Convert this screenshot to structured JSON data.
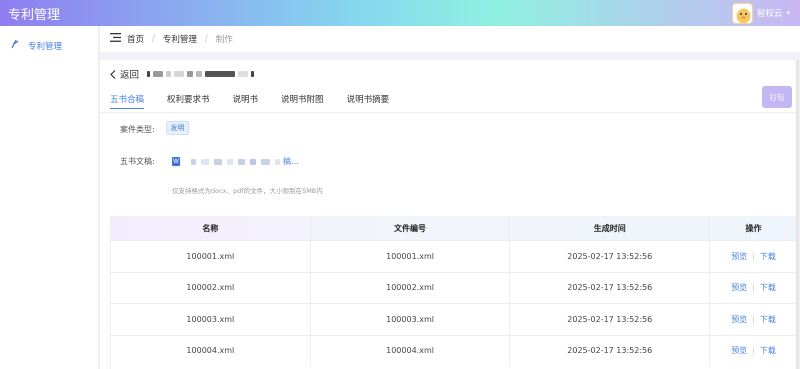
{
  "app": {
    "title": "专利管理",
    "user_name": "智权云"
  },
  "sidebar": {
    "items": [
      {
        "label": "专利管理",
        "icon": "patent-icon"
      }
    ]
  },
  "breadcrumb": {
    "items": [
      "首页",
      "专利管理",
      "制作"
    ]
  },
  "page": {
    "back_label": "返回"
  },
  "tabs": [
    "五书合稿",
    "权利要求书",
    "说明书",
    "说明书附图",
    "说明书摘要"
  ],
  "print_button": "打包",
  "form": {
    "case_type_label": "案件类型:",
    "case_type_value": "发明",
    "doc_label": "五书文稿:",
    "file_suffix": "稿…",
    "hint": "仅支持格式为docx、pdf的文件，大小限制在5MB内"
  },
  "table": {
    "headers": [
      "名称",
      "文件编号",
      "生成时间",
      "操作"
    ],
    "rows": [
      {
        "name": "100001.xml",
        "code": "100001.xml",
        "time": "2025-02-17 13:52:56"
      },
      {
        "name": "100002.xml",
        "code": "100002.xml",
        "time": "2025-02-17 13:52:56"
      },
      {
        "name": "100003.xml",
        "code": "100003.xml",
        "time": "2025-02-17 13:52:56"
      },
      {
        "name": "100004.xml",
        "code": "100004.xml",
        "time": "2025-02-17 13:52:56"
      }
    ],
    "actions": {
      "preview": "预览",
      "download": "下载"
    }
  },
  "colors": {
    "accent": "#4a7fe0",
    "print_button": "#c2b6f3"
  }
}
